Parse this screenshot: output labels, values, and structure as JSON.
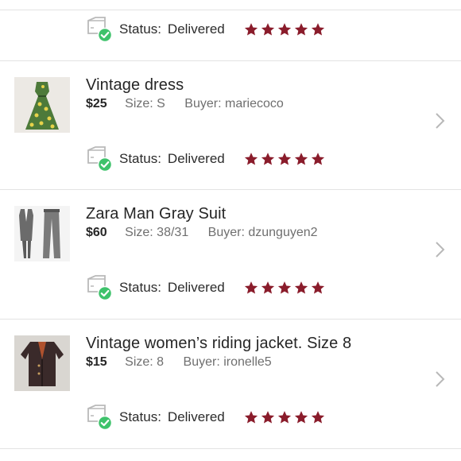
{
  "colors": {
    "star": "#8a1c2b",
    "check": "#3ec26b",
    "divider": "#e3e3e3",
    "chevron": "#b8b8b8"
  },
  "icons": {
    "status": "box-delivered-icon",
    "rating": "star-icon",
    "open": "chevron-right-icon"
  },
  "orders": [
    {
      "status_label": "Status:",
      "status_value": "Delivered",
      "rating": 5
    },
    {
      "title": "Vintage dress",
      "price": "$25",
      "size": "Size: S",
      "buyer": "Buyer: mariecoco",
      "status_label": "Status:",
      "status_value": "Delivered",
      "rating": 5
    },
    {
      "title": "Zara Man Gray Suit",
      "price": "$60",
      "size": "Size: 38/31",
      "buyer": "Buyer: dzunguyen2",
      "status_label": "Status:",
      "status_value": "Delivered",
      "rating": 5
    },
    {
      "title": "Vintage women’s riding jacket. Size 8",
      "price": "$15",
      "size": "Size: 8",
      "buyer": "Buyer: ironelle5",
      "status_label": "Status:",
      "status_value": "Delivered",
      "rating": 5
    }
  ]
}
